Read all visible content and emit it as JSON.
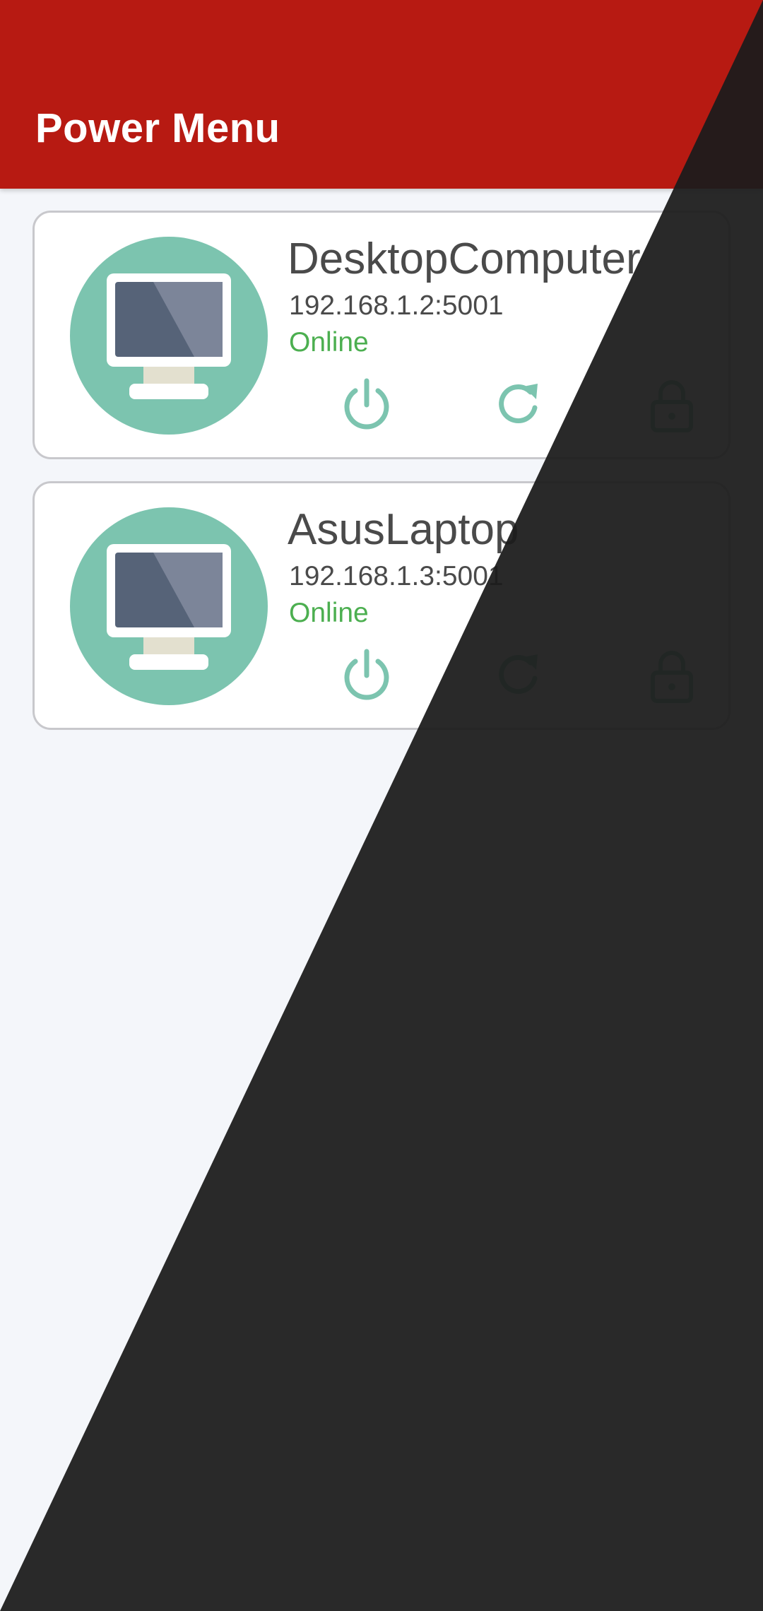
{
  "app_bar": {
    "title": "Power Menu",
    "color": "#b71a12"
  },
  "devices": [
    {
      "name": "DesktopComputer",
      "address": "192.168.1.2:5001",
      "status": "Online",
      "icon": "monitor-icon",
      "actions": [
        "power-icon",
        "restart-icon",
        "lock-icon"
      ]
    },
    {
      "name": "AsusLaptop",
      "address": "192.168.1.3:5001",
      "status": "Online",
      "icon": "monitor-icon",
      "actions": [
        "power-icon",
        "restart-icon",
        "lock-icon"
      ]
    }
  ],
  "colors": {
    "accent": "#7cc4af",
    "status_online": "#4caf50",
    "background": "#f4f6fa",
    "overlay_dark": "#1c1c1c"
  }
}
